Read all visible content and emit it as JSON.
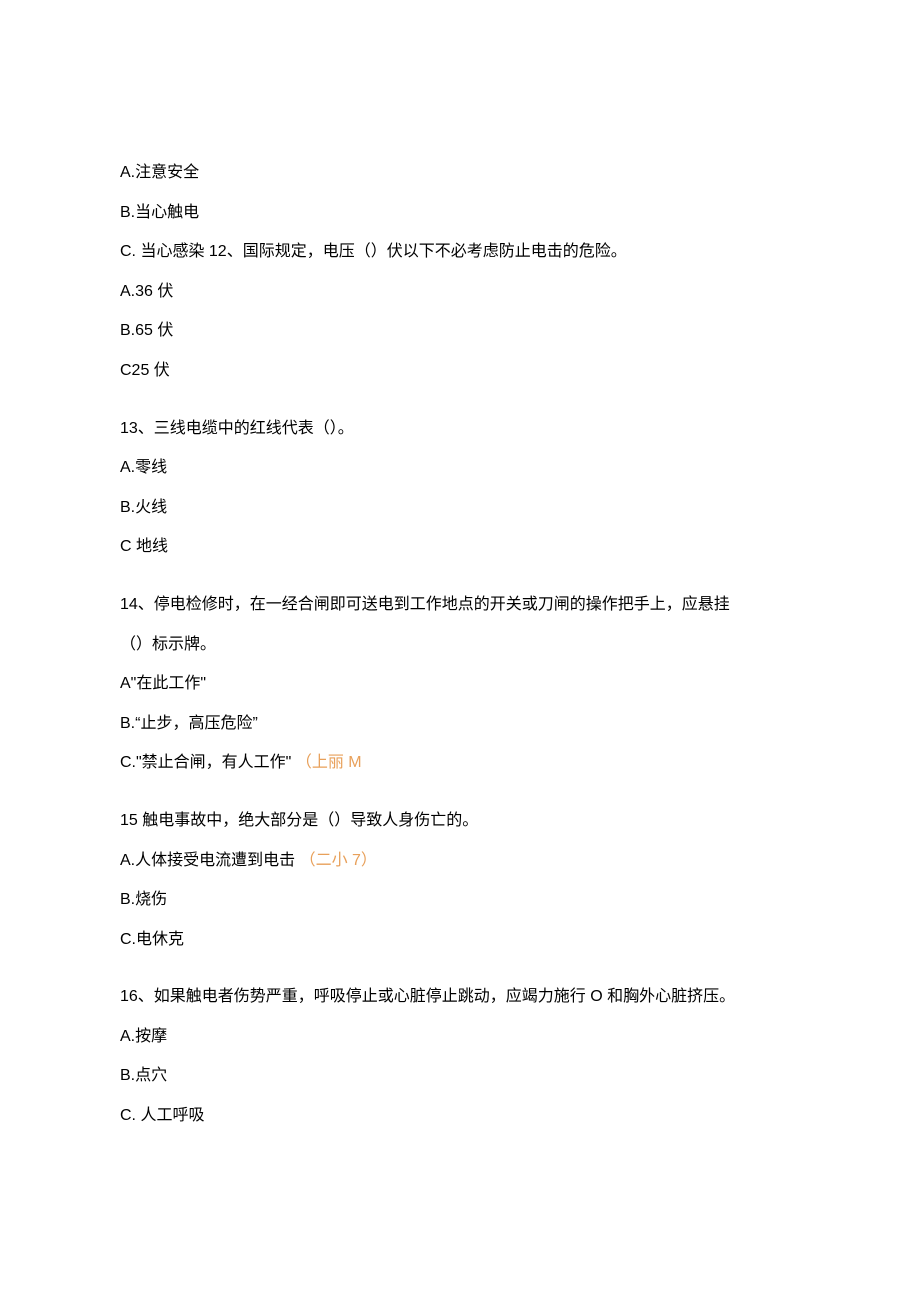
{
  "q11_options": {
    "a": "A.注意安全",
    "b": "B.当心触电",
    "c_prefix": "C. 当心感染 ",
    "q12_inline": "12、国际规定，电压（）伏以下不必考虑防止电击的危险。"
  },
  "q12_options": {
    "a": "A.36 伏",
    "b": "B.65 伏",
    "c": "C25 伏"
  },
  "q13": {
    "stem": "13、三线电缆中的红线代表（）。",
    "a": "A.零线",
    "b": "B.火线",
    "c": "C 地线"
  },
  "q14": {
    "stem_line1": "14、停电检修时，在一经合闸即可送电到工作地点的开关或刀闸的操作把手上，应悬挂",
    "stem_line2": "（）标示牌。",
    "a": "A\"在此工作\"",
    "b": "B.“止步，高压危险”",
    "c_text": "C.\"禁止合闸，有人工作\"",
    "c_annotation": "（上丽 M"
  },
  "q15": {
    "stem": "15 触电事故中，绝大部分是（）导致人身伤亡的。",
    "a_text": "A.人体接受电流遭到电击",
    "a_annotation": "（二小 7）",
    "b": "B.烧伤",
    "c": "C.电休克"
  },
  "q16": {
    "stem": "16、如果触电者伤势严重，呼吸停止或心脏停止跳动，应竭力施行 O 和胸外心脏挤压。",
    "a": "A.按摩",
    "b": "B.点穴",
    "c": "C. 人工呼吸"
  }
}
